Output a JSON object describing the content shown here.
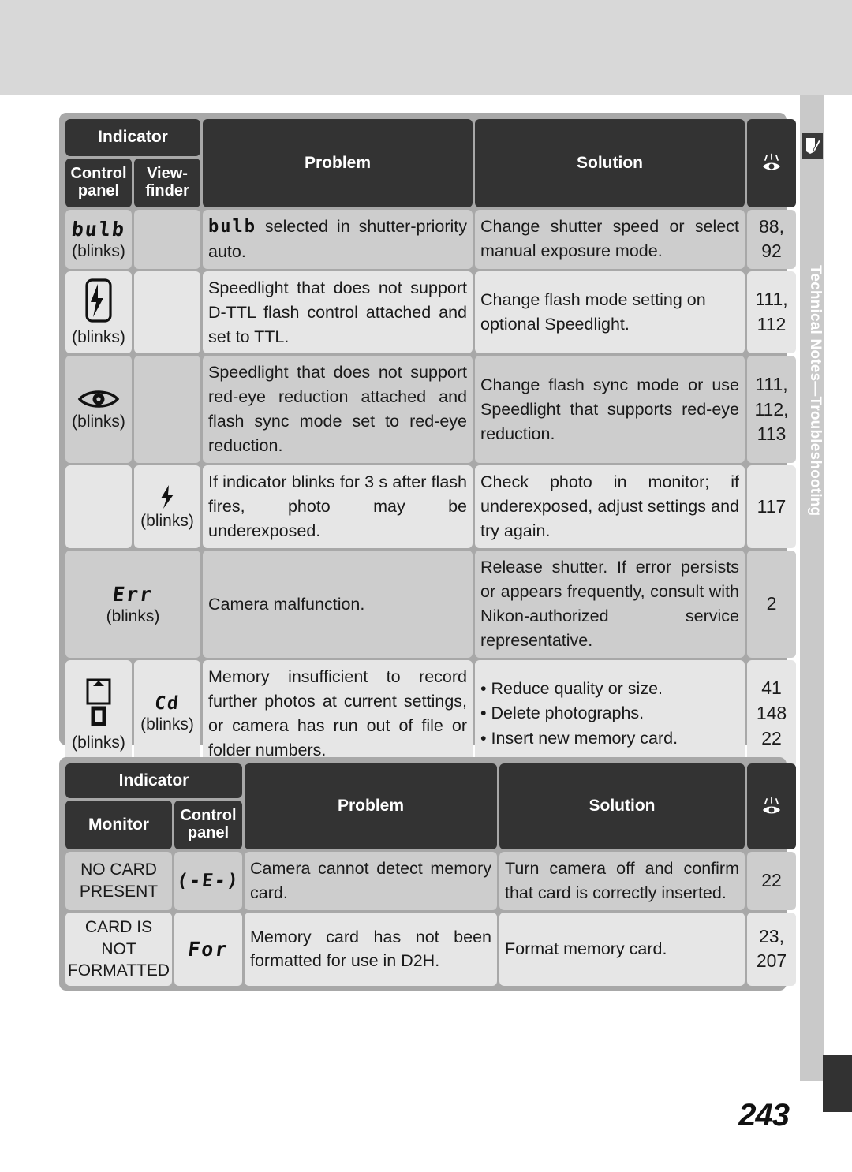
{
  "page": {
    "number": "243",
    "sidebar_label": "Technical Notes—Troubleshooting",
    "sidebar_icon": "note-pencil-icon",
    "reference_icon": "eye-reference-icon"
  },
  "table1": {
    "headers": {
      "indicator": "Indicator",
      "control_panel": "Control panel",
      "control_panel_l1": "Control",
      "control_panel_l2": "panel",
      "viewfinder_l1": "View-",
      "viewfinder_l2": "finder",
      "problem": "Problem",
      "solution": "Solution",
      "reference_icon": "eye-reference-icon"
    },
    "rows": [
      {
        "control_panel": "bulb",
        "control_panel_type": "lcd",
        "control_panel_note": "(blinks)",
        "viewfinder": "",
        "viewfinder_type": "empty",
        "viewfinder_note": "",
        "problem_lcd_prefix": "bulb",
        "problem": " selected in shutter-priority auto.",
        "solution": "Change shutter speed or select manual exposure mode.",
        "solution_type": "text",
        "ref": "88, 92"
      },
      {
        "control_panel": "flash-in-frame-icon",
        "control_panel_type": "icon",
        "control_panel_note": "(blinks)",
        "viewfinder": "",
        "viewfinder_type": "empty",
        "viewfinder_note": "",
        "problem": "Speedlight that does not support D-TTL flash control attached and set to TTL.",
        "solution": "Change flash mode setting on optional Speedlight.",
        "solution_type": "text",
        "ref": "111, 112"
      },
      {
        "control_panel": "eye-icon",
        "control_panel_type": "icon",
        "control_panel_note": "(blinks)",
        "viewfinder": "",
        "viewfinder_type": "empty",
        "viewfinder_note": "",
        "problem": "Speedlight that does not support red-eye reduction attached and flash sync mode set to red-eye reduction.",
        "solution": "Change flash sync mode or use Speedlight that supports red-eye reduction.",
        "solution_type": "text",
        "ref": "111, 112, 113"
      },
      {
        "control_panel": "",
        "control_panel_type": "empty",
        "control_panel_note": "",
        "viewfinder": "flash-bolt-icon",
        "viewfinder_type": "icon",
        "viewfinder_note": "(blinks)",
        "problem": "If indicator blinks for 3 s after flash fires, photo may be underexposed.",
        "solution": "Check photo in monitor; if underexposed, adjust settings and try again.",
        "solution_type": "text",
        "ref": "117"
      },
      {
        "control_panel": "Err",
        "control_panel_type": "lcd-span",
        "control_panel_note": "(blinks)",
        "viewfinder": "",
        "viewfinder_type": "merged",
        "viewfinder_note": "",
        "problem": "Camera malfunction.",
        "solution": "Release shutter. If error persists or appears frequently, consult with Nikon-authorized service representative.",
        "solution_type": "text",
        "ref": "2"
      },
      {
        "control_panel": "card-icon-zero",
        "control_panel_type": "icon",
        "control_panel_note": "(blinks)",
        "viewfinder": "Cd",
        "viewfinder_type": "lcd",
        "viewfinder_note": "(blinks)",
        "problem": "Memory insufficient to record further photos at current settings, or camera has run out of file or folder numbers.",
        "solution_list": [
          "Reduce quality or size.",
          "Delete photographs.",
          "Insert new memory card."
        ],
        "solution_type": "list",
        "ref": "41 148 22"
      }
    ]
  },
  "table2": {
    "headers": {
      "indicator": "Indicator",
      "monitor": "Monitor",
      "control_panel_l1": "Control",
      "control_panel_l2": "panel",
      "problem": "Problem",
      "solution": "Solution",
      "reference_icon": "eye-reference-icon"
    },
    "rows": [
      {
        "monitor_l1": "NO CARD",
        "monitor_l2": "PRESENT",
        "control_panel": "(-E-)",
        "problem": "Camera cannot detect memory card.",
        "solution": "Turn camera off and confirm that card is correctly inserted.",
        "ref": "22"
      },
      {
        "monitor_l1": "CARD IS NOT",
        "monitor_l2": "FORMATTED",
        "control_panel": "For",
        "problem": "Memory card has not been formatted for use in D2H.",
        "solution": "Format memory card.",
        "ref": "23, 207"
      }
    ]
  },
  "colors": {
    "header_bg": "#333333",
    "row_light": "#e6e6e6",
    "row_dark": "#cdcdcd",
    "table_border": "#a8a8a8",
    "sidebar": "#c9c9c9",
    "top_band": "#d8d8d8"
  }
}
